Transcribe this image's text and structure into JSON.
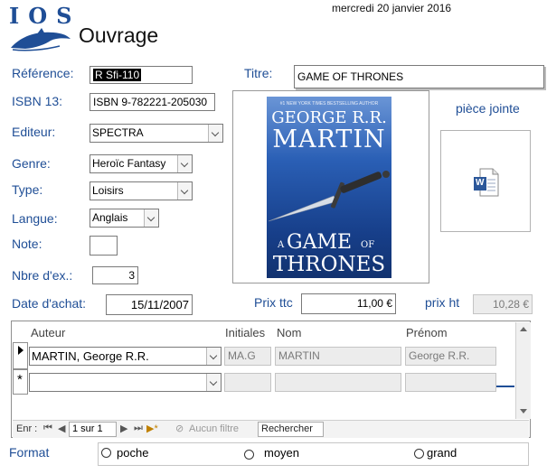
{
  "header": {
    "logo_text": "IOS",
    "title": "Ouvrage",
    "date": "mercredi 20 janvier 2016"
  },
  "form": {
    "reference_label": "Référence:",
    "reference_value": "R Sfi-110",
    "isbn_label": "ISBN 13:",
    "isbn_value": "ISBN 9-782221-205030",
    "editeur_label": "Editeur:",
    "editeur_value": "SPECTRA",
    "genre_label": "Genre:",
    "genre_value": "Heroïc Fantasy",
    "type_label": "Type:",
    "type_value": "Loisirs",
    "langue_label": "Langue:",
    "langue_value": "Anglais",
    "note_label": "Note:",
    "note_value": "",
    "nbre_label": "Nbre d'ex.:",
    "nbre_value": "3",
    "date_achat_label": "Date d'achat:",
    "date_achat_value": "15/11/2007",
    "titre_label": "Titre:",
    "titre_value": "GAME OF THRONES",
    "prix_ttc_label": "Prix ttc",
    "prix_ttc_value": "11,00 €",
    "prix_ht_label": "prix ht",
    "prix_ht_value": "10,28 €",
    "piece_jointe_label": "pièce jointe"
  },
  "cover": {
    "top_line": "#1 NEW YORK TIMES BESTSELLING AUTHOR",
    "author_line1": "GEORGE R.R.",
    "author_line2": "MARTIN",
    "title_a": "A",
    "title_game": "GAME",
    "title_of": "OF",
    "title_thrones": "THRONES"
  },
  "attachment": {
    "icon": "word-document-icon",
    "letter": "W"
  },
  "subform": {
    "columns": [
      "Auteur",
      "Initiales",
      "Nom",
      "Prénom"
    ],
    "rows": [
      {
        "auteur": "MARTIN, George  R.R.",
        "initiales": "MA.G",
        "nom": "MARTIN",
        "prenom": "George  R.R."
      }
    ],
    "new_row_marker": "*"
  },
  "navigation": {
    "label": "Enr :",
    "position": "1 sur 1",
    "filter": "Aucun filtre",
    "search": "Rechercher"
  },
  "format": {
    "label": "Format",
    "options": [
      "poche",
      "moyen",
      "grand"
    ]
  },
  "colors": {
    "label_blue": "#1f4e96",
    "cover_blue": "#1d4fa0",
    "logo_blue": "#1f4e96"
  }
}
